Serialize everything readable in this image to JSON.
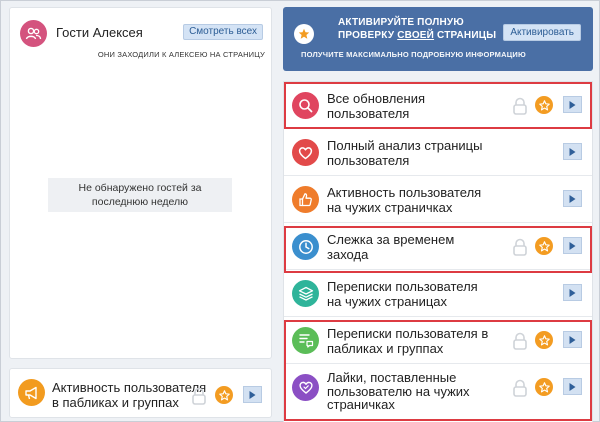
{
  "guests": {
    "title": "Гости Алексея",
    "see_all_label": "Смотреть всех",
    "subtitle": "ОНИ ЗАХОДИЛИ К АЛЕКСЕЮ НА СТРАНИЦУ",
    "empty_line1": "Не обнаружено гостей за",
    "empty_line2": "последнюю неделю",
    "icon": "users-icon"
  },
  "public_activity": {
    "line1": "Активность пользователя",
    "line2": "в пабликах и группах",
    "icon": "megaphone-icon",
    "locked": true
  },
  "promo": {
    "line1": "АКТИВИРУЙТЕ ПОЛНУЮ",
    "line2_before": "ПРОВЕРКУ ",
    "line2_link": "СВОЕЙ",
    "line2_after": " СТРАНИЦЫ",
    "line3": "ПОЛУЧИТЕ МАКСИМАЛЬНО ПОДРОБНУЮ ИНФОРМАЦИЮ",
    "activate_label": "Активировать",
    "background": "#4a6fa5"
  },
  "features": [
    {
      "line1": "Все обновления",
      "line2": "пользователя",
      "icon": "search-user-icon",
      "color": "#e0455f",
      "locked": true,
      "highlighted": true
    },
    {
      "line1": "Полный анализ страницы",
      "line2": "пользователя",
      "icon": "heart-icon",
      "color": "#e24a4a",
      "locked": false,
      "highlighted": false
    },
    {
      "line1": "Активность пользователя",
      "line2": "на чужих страничках",
      "icon": "thumbs-up-icon",
      "color": "#ef7c2b",
      "locked": false,
      "highlighted": false
    },
    {
      "line1": "Слежка за временем",
      "line2": "захода",
      "icon": "clock-icon",
      "color": "#3b8fce",
      "locked": true,
      "highlighted": true
    },
    {
      "line1": "Переписки пользователя",
      "line2": "на чужих страницах",
      "icon": "layers-icon",
      "color": "#2fb49a",
      "locked": false,
      "highlighted": false
    },
    {
      "line1": "Переписки пользователя в",
      "line2": "пабликах и группах",
      "icon": "chat-list-icon",
      "color": "#5bbd58",
      "locked": true,
      "highlighted": true
    },
    {
      "line1": "Лайки, поставленные",
      "line2": "пользователю на чужих",
      "line3": "страничках",
      "icon": "heart-badge-icon",
      "color": "#8b4fc4",
      "locked": true,
      "highlighted": true
    }
  ],
  "colors": {
    "accent_orange": "#f39c22",
    "highlight_red": "#dd3b42",
    "button_blue": "#d4e3f5"
  }
}
